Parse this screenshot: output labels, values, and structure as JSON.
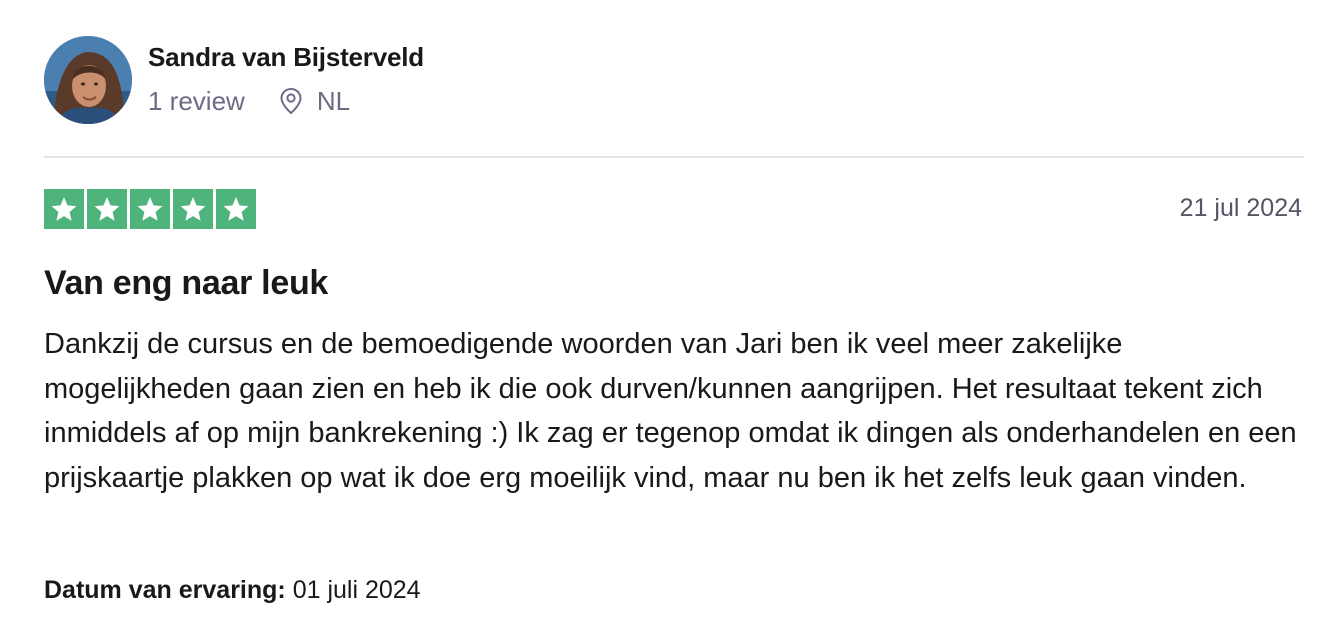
{
  "reviewer": {
    "name": "Sandra van Bijsterveld",
    "review_count": "1 review",
    "location_icon": "location-pin-icon",
    "country": "NL"
  },
  "rating": {
    "stars": 5,
    "max": 5,
    "star_color": "#4fb47b"
  },
  "review": {
    "date": "21 jul 2024",
    "title": "Van eng naar leuk",
    "body": "Dankzij de cursus en de bemoedigende woorden van Jari ben ik veel meer zakelijke mogelijkheden gaan zien en heb ik die ook durven/kunnen aangrijpen. Het resultaat tekent zich inmiddels af op mijn bankrekening :) Ik zag er tegenop omdat ik dingen als onderhandelen en een prijskaartje plakken op wat ik doe erg moeilijk vind, maar nu ben ik het zelfs leuk gaan vinden.",
    "experience_label": "Datum van ervaring:",
    "experience_date": "01 juli 2024"
  }
}
